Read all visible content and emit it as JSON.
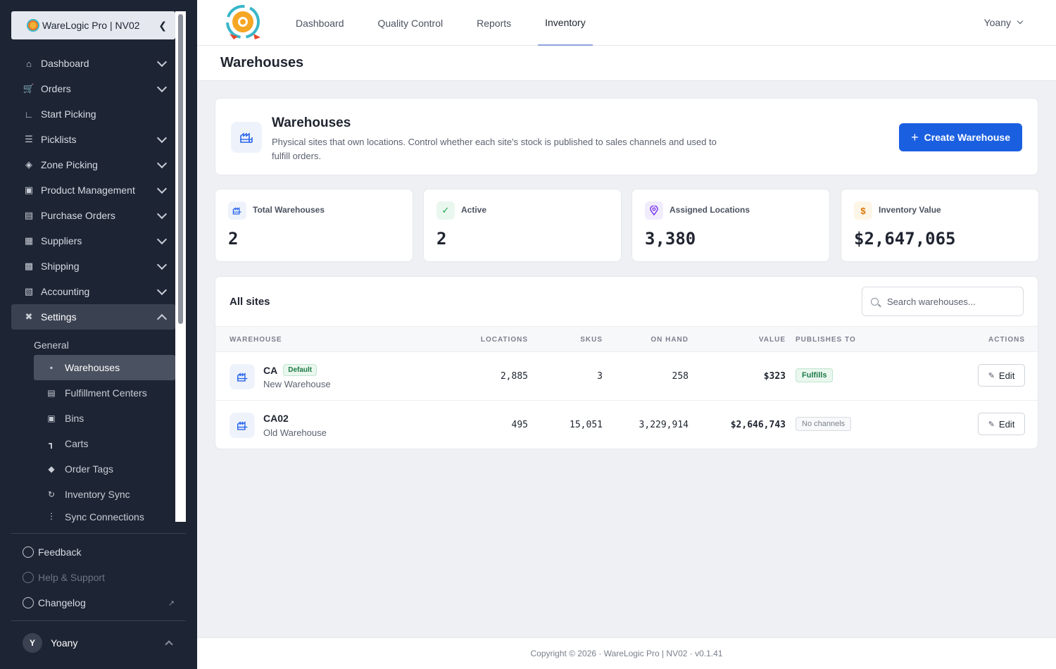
{
  "sidebar": {
    "brand": "WareLogic Pro | NV02",
    "items": [
      {
        "label": "Dashboard",
        "icon": "home-icon"
      },
      {
        "label": "Orders",
        "icon": "cart-icon"
      },
      {
        "label": "Start Picking",
        "icon": "hand-truck-icon"
      },
      {
        "label": "Picklists",
        "icon": "checklist-icon"
      },
      {
        "label": "Zone Picking",
        "icon": "layers-icon"
      },
      {
        "label": "Product Management",
        "icon": "boxes-icon"
      },
      {
        "label": "Purchase Orders",
        "icon": "document-icon"
      },
      {
        "label": "Suppliers",
        "icon": "warehouse-icon"
      },
      {
        "label": "Shipping",
        "icon": "truck-icon"
      },
      {
        "label": "Accounting",
        "icon": "invoice-icon"
      },
      {
        "label": "Settings",
        "icon": "tools-icon"
      }
    ],
    "settings_group": "General",
    "sub_items": [
      {
        "label": "Warehouses",
        "icon": "warehouse-icon"
      },
      {
        "label": "Fulfillment Centers",
        "icon": "building-icon"
      },
      {
        "label": "Bins",
        "icon": "box-icon"
      },
      {
        "label": "Carts",
        "icon": "cart-dolly-icon"
      },
      {
        "label": "Order Tags",
        "icon": "tags-icon"
      },
      {
        "label": "Inventory Sync",
        "icon": "sync-icon"
      },
      {
        "label": "Sync Connections",
        "icon": "plug-icon"
      }
    ],
    "bottom": {
      "feedback": "Feedback",
      "help": "Help & Support",
      "changelog": "Changelog"
    },
    "user": {
      "initial": "Y",
      "name": "Yoany"
    }
  },
  "topnav": {
    "tabs": [
      "Dashboard",
      "Quality Control",
      "Reports",
      "Inventory"
    ],
    "active_tab": "Inventory",
    "user": "Yoany"
  },
  "page": {
    "title": "Warehouses",
    "hero_title": "Warehouses",
    "hero_desc": "Physical sites that own locations. Control whether each site's stock is published to sales channels and used to fulfill orders.",
    "create_label": "Create Warehouse"
  },
  "stats": [
    {
      "label": "Total Warehouses",
      "value": "2",
      "icon": "warehouse-icon",
      "color": "#2563eb"
    },
    {
      "label": "Active",
      "value": "2",
      "icon": "check-icon",
      "color": "#16a34a"
    },
    {
      "label": "Assigned Locations",
      "value": "3,380",
      "icon": "map-pin-icon",
      "color": "#7c3aed"
    },
    {
      "label": "Inventory Value",
      "value": "$2,647,065",
      "icon": "dollar-icon",
      "color": "#d97706"
    }
  ],
  "table": {
    "title": "All sites",
    "search_placeholder": "Search warehouses...",
    "columns": [
      "WAREHOUSE",
      "LOCATIONS",
      "SKUS",
      "ON HAND",
      "VALUE",
      "PUBLISHES TO",
      "ACTIONS"
    ],
    "rows": [
      {
        "code": "CA",
        "badge": "Default",
        "name": "New Warehouse",
        "locations": "2,885",
        "skus": "3",
        "on_hand": "258",
        "value": "$323",
        "publishes": "Fulfills",
        "action": "Edit"
      },
      {
        "code": "CA02",
        "badge": "",
        "name": "Old Warehouse",
        "locations": "495",
        "skus": "15,051",
        "on_hand": "3,229,914",
        "value": "$2,646,743",
        "publishes": "No channels",
        "action": "Edit"
      }
    ]
  },
  "footer": "Copyright © 2026 · WareLogic Pro | NV02 · v0.1.41"
}
